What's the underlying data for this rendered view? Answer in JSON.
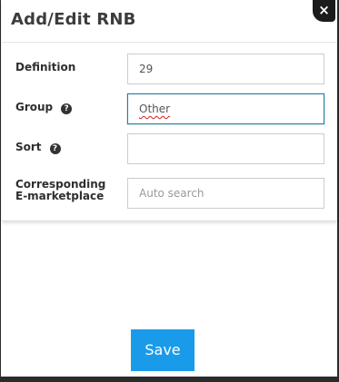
{
  "dialog": {
    "title": "Add/Edit RNB",
    "close_label": "×"
  },
  "form": {
    "definition": {
      "label": "Definition",
      "value": "29"
    },
    "group": {
      "label": "Group",
      "help_icon": "question-circle",
      "value": "Other"
    },
    "sort": {
      "label": "Sort",
      "help_icon": "question-circle",
      "value": ""
    },
    "marketplace": {
      "label_line1": "Corresponding",
      "label_line2": "E-marketplace",
      "placeholder": "Auto search"
    }
  },
  "actions": {
    "save_label": "Save"
  },
  "colors": {
    "accent": "#1a9be9",
    "focus_border": "#1d7fa3",
    "close_bg": "#1b1b1b"
  }
}
